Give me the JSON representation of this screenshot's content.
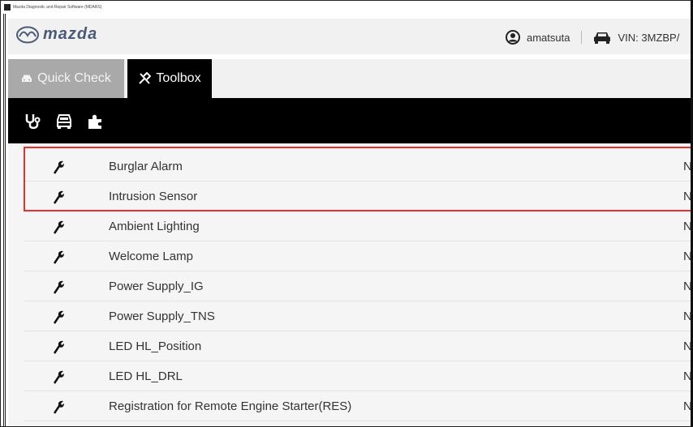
{
  "window": {
    "title": "Mazda Diagnostic and Repair Software (MDARS)"
  },
  "header": {
    "brand": "mazda",
    "username": "amatsuta",
    "vin": "VIN: 3MZBP/"
  },
  "tabs": [
    {
      "label": "Quick Check",
      "icon": "car-icon",
      "active": false
    },
    {
      "label": "Toolbox",
      "icon": "tools-icon",
      "active": true
    }
  ],
  "toolbar_icons": [
    "stethoscope-icon",
    "vehicle-icon",
    "puzzle-icon"
  ],
  "rows": [
    {
      "label": "Burglar Alarm",
      "status": "N"
    },
    {
      "label": "Intrusion Sensor",
      "status": "N"
    },
    {
      "label": "Ambient Lighting",
      "status": "N"
    },
    {
      "label": "Welcome Lamp",
      "status": "N"
    },
    {
      "label": "Power Supply_IG",
      "status": "N"
    },
    {
      "label": "Power Supply_TNS",
      "status": "N"
    },
    {
      "label": "LED HL_Position",
      "status": "N"
    },
    {
      "label": "LED HL_DRL",
      "status": "N"
    },
    {
      "label": "Registration for Remote Engine Starter(RES)",
      "status": "N"
    }
  ],
  "colors": {
    "highlight": "#e53030",
    "toolbar_bg": "#000000",
    "inactive_tab": "#a9a9a9"
  }
}
